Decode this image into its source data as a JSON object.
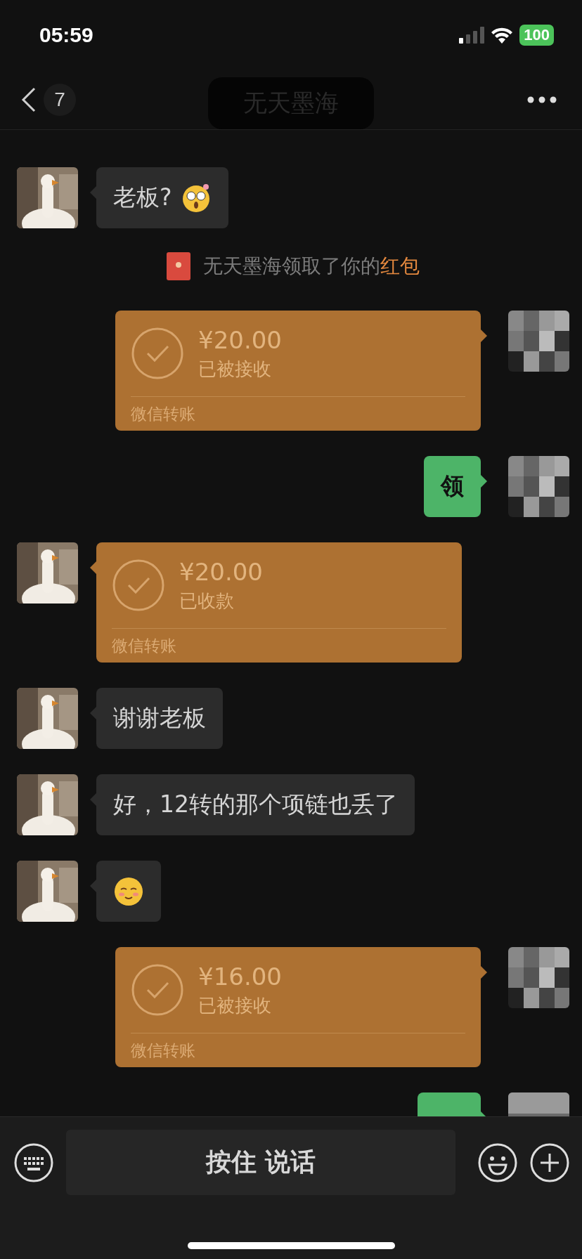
{
  "status_bar": {
    "time": "05:59",
    "battery": "100"
  },
  "nav": {
    "back_count": "7",
    "title": "无天墨海"
  },
  "messages": [
    {
      "kind": "text",
      "outgoing": false,
      "text": "老板?",
      "sticker": true
    },
    {
      "kind": "notice",
      "text": "无天墨海领取了你的",
      "link": "红包"
    },
    {
      "kind": "transfer",
      "outgoing": true,
      "amount": "¥20.00",
      "status": "已被接收",
      "label": "微信转账"
    },
    {
      "kind": "text",
      "outgoing": true,
      "text": "领",
      "sticker": false
    },
    {
      "kind": "transfer",
      "outgoing": false,
      "amount": "¥20.00",
      "status": "已收款",
      "label": "微信转账"
    },
    {
      "kind": "text",
      "outgoing": false,
      "text": "谢谢老板",
      "sticker": false
    },
    {
      "kind": "text",
      "outgoing": false,
      "text": "好，12转的那个项链也丢了",
      "sticker": false
    },
    {
      "kind": "sticker",
      "outgoing": false
    },
    {
      "kind": "transfer",
      "outgoing": true,
      "amount": "¥16.00",
      "status": "已被接收",
      "label": "微信转账"
    },
    {
      "kind": "text",
      "outgoing": true,
      "sticker": false
    }
  ],
  "input_bar": {
    "voice_button": "按住 说话"
  }
}
